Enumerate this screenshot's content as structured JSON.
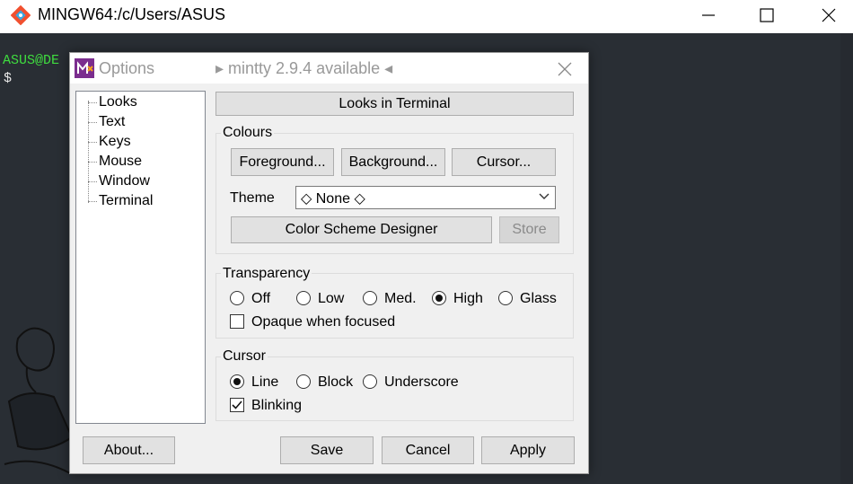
{
  "window": {
    "title": "MINGW64:/c/Users/ASUS"
  },
  "terminal": {
    "prompt_user": "ASUS@DE",
    "prompt_symbol": "$"
  },
  "dialog": {
    "title": "Options",
    "update_notice": "▸ mintty 2.9.4 available ◂",
    "tree": [
      "Looks",
      "Text",
      "Keys",
      "Mouse",
      "Window",
      "Terminal"
    ],
    "section_header": "Looks in Terminal",
    "colours": {
      "label": "Colours",
      "foreground": "Foreground...",
      "background": "Background...",
      "cursor": "Cursor...",
      "theme_label": "Theme",
      "theme_value": "◇ None ◇",
      "designer": "Color Scheme Designer",
      "store": "Store"
    },
    "transparency": {
      "label": "Transparency",
      "options": [
        "Off",
        "Low",
        "Med.",
        "High",
        "Glass"
      ],
      "selected": "High",
      "opaque_label": "Opaque when focused",
      "opaque_checked": false
    },
    "cursor": {
      "label": "Cursor",
      "options": [
        "Line",
        "Block",
        "Underscore"
      ],
      "selected": "Line",
      "blinking_label": "Blinking",
      "blinking_checked": true
    },
    "buttons": {
      "about": "About...",
      "save": "Save",
      "cancel": "Cancel",
      "apply": "Apply"
    }
  },
  "colors": {
    "terminal_bg": "#292e34",
    "prompt_green": "#3fdc3f",
    "dialog_bg": "#f0f0f0"
  },
  "icons": [
    "git-bash-icon",
    "minimize-icon",
    "maximize-icon",
    "close-icon",
    "mintty-icon",
    "dialog-close-icon",
    "dropdown-arrow-icon",
    "checkmark-icon"
  ]
}
